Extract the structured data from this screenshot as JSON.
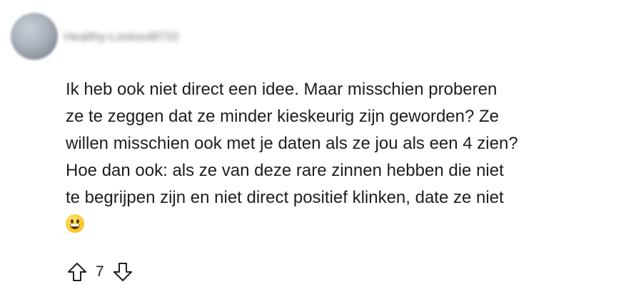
{
  "comment": {
    "username": "Healthy-Lockout8732",
    "body_lines": [
      "Ik heb ook niet direct een idee. Maar misschien proberen",
      "ze te zeggen dat ze minder kieskeurig zijn geworden? Ze",
      "willen misschien ook met je daten als ze jou als een 4 zien?",
      "Hoe dan ook: als ze van deze rare zinnen hebben die niet",
      "te begrijpen zijn en niet direct positief klinken, date ze niet"
    ],
    "emoji": "grinning-face-emoji",
    "score": "7"
  },
  "icons": {
    "upvote": "arrow-up-outline-icon",
    "downvote": "arrow-down-outline-icon"
  },
  "colors": {
    "text": "#1c1e21",
    "icon": "#1c1e21",
    "background": "#ffffff"
  }
}
